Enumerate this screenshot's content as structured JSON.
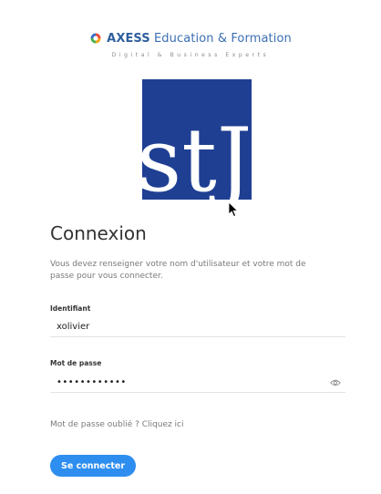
{
  "brand": {
    "name_strong": "AXESS",
    "name_rest": " Education & Formation",
    "tagline": "Digital & Business Experts",
    "logo_icon": "axess-ring-logo-icon"
  },
  "school_logo": {
    "text": "stJo",
    "background": "#1f3f93"
  },
  "form": {
    "title": "Connexion",
    "description": "Vous devez renseigner votre nom d'utilisateur et votre mot de passe pour vous connecter.",
    "username_label": "Identifiant",
    "username_value": "xolivier",
    "password_label": "Mot de passe",
    "password_value": "••••••••••••",
    "password_toggle_icon": "eye-icon",
    "forgot_text": "Mot de passe oublié ? Cliquez ici",
    "submit_label": "Se connecter"
  },
  "colors": {
    "accent": "#2e8ef0",
    "brand_blue": "#2f5f9e"
  }
}
